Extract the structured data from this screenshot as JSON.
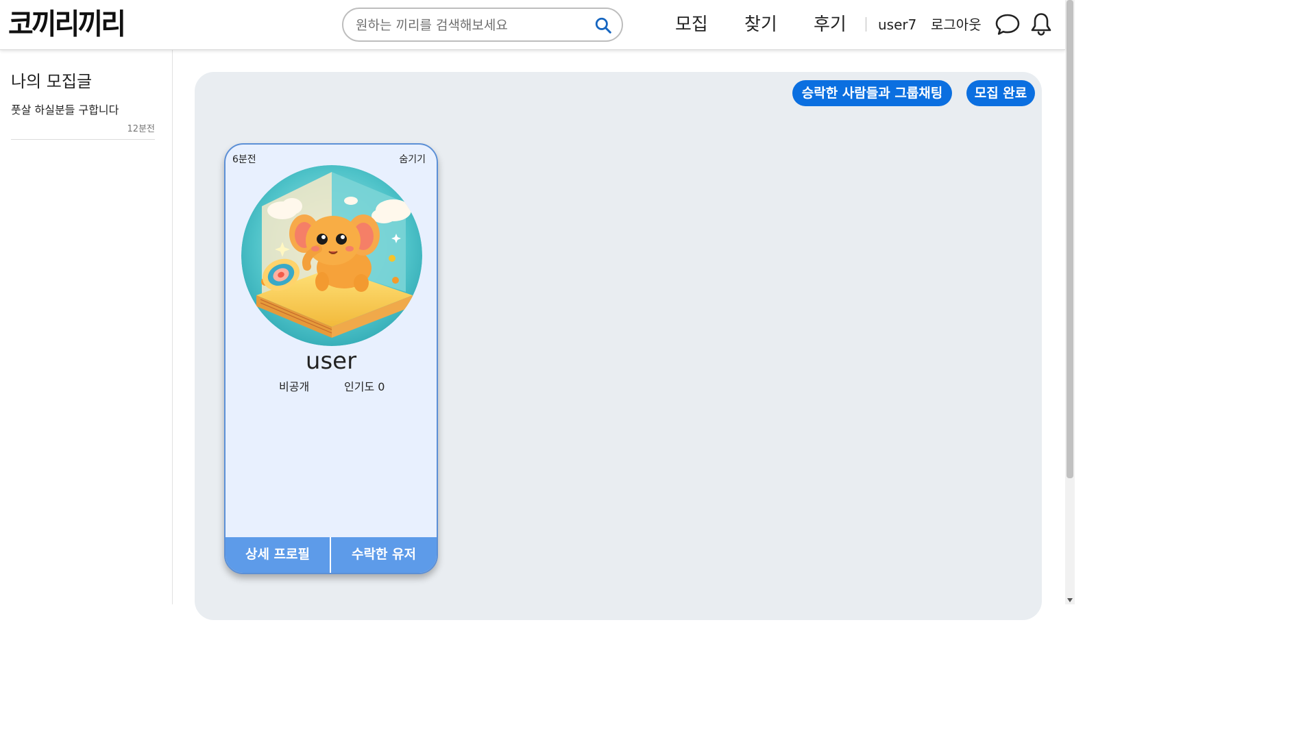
{
  "header": {
    "logo_text": "코끼리끼리",
    "search": {
      "placeholder": "원하는 끼리를 검색해보세요",
      "value": ""
    },
    "nav": [
      {
        "label": "모집"
      },
      {
        "label": "찾기"
      },
      {
        "label": "후기"
      }
    ],
    "user_name": "user7",
    "logout_label": "로그아웃",
    "icons": [
      "search-icon",
      "chat-icon",
      "bell-icon"
    ]
  },
  "sidebar": {
    "title": "나의 모집글",
    "posts": [
      {
        "title": "풋살 하실분들 구합니다",
        "time": "12분전"
      }
    ]
  },
  "main": {
    "group_chat_label": "승락한 사람들과 그룹채팅",
    "complete_label": "모집 완료",
    "cards": [
      {
        "time": "6분전",
        "hide_label": "숨기기",
        "username": "user",
        "visibility": "비공개",
        "popularity_label": "인기도",
        "popularity_value": "0",
        "detail_label": "상세 프로필",
        "accepted_label": "수락한 유저"
      }
    ]
  },
  "colors": {
    "accent": "#0b6fe0",
    "card_bg": "#e8f0fe",
    "card_footer": "#5d9be9",
    "panel_bg": "#e9edf1",
    "card_border": "#5b8fd6"
  }
}
